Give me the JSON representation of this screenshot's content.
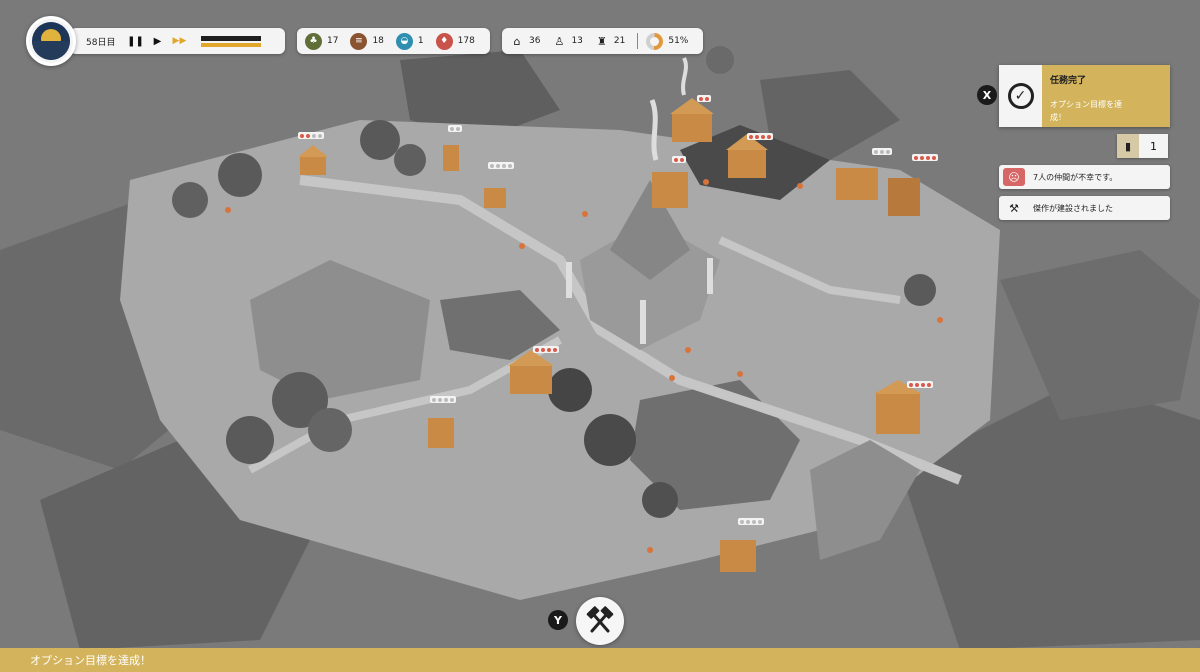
{
  "hud": {
    "day_label": "58日目",
    "controls": {
      "pause": "❚❚",
      "play": "▶",
      "fast_forward": "▶▶"
    },
    "resources": [
      {
        "key": "food",
        "icon": "food-icon",
        "glyph": "♣",
        "value": "17"
      },
      {
        "key": "wood",
        "icon": "wood-icon",
        "glyph": "≡",
        "value": "18"
      },
      {
        "key": "stone",
        "icon": "stone-icon",
        "glyph": "◒",
        "value": "1"
      },
      {
        "key": "gold",
        "icon": "gold-icon",
        "glyph": "♦",
        "value": "178"
      }
    ],
    "population": [
      {
        "key": "houses",
        "icon": "house-icon",
        "glyph": "⌂",
        "value": "36"
      },
      {
        "key": "villagers",
        "icon": "villager-icon",
        "glyph": "♙",
        "value": "13"
      },
      {
        "key": "workers",
        "icon": "worker-icon",
        "glyph": "♜",
        "value": "21"
      }
    ],
    "happiness": {
      "icon": "happiness-icon",
      "value": "51%"
    }
  },
  "quest": {
    "button": "X",
    "title": "任務完了",
    "text_line1": "オプション目標を達",
    "text_line2": "成！"
  },
  "counter": {
    "glyph": "▮",
    "value": "1"
  },
  "notifications": [
    {
      "icon": "sad-face-icon",
      "glyph": "☹",
      "text": "7人の仲間が不幸です。"
    },
    {
      "icon": "hammers-icon",
      "glyph": "⚒",
      "text": "傑作が建設されました"
    }
  ],
  "build": {
    "button": "Y",
    "icon": "build-hammers-icon"
  },
  "banner": {
    "text": "オプション目標を達成！"
  },
  "colors": {
    "accent": "#d3b45c",
    "building": "#c98a45",
    "alert": "#d85a4a",
    "world": "#7d7d7d"
  }
}
